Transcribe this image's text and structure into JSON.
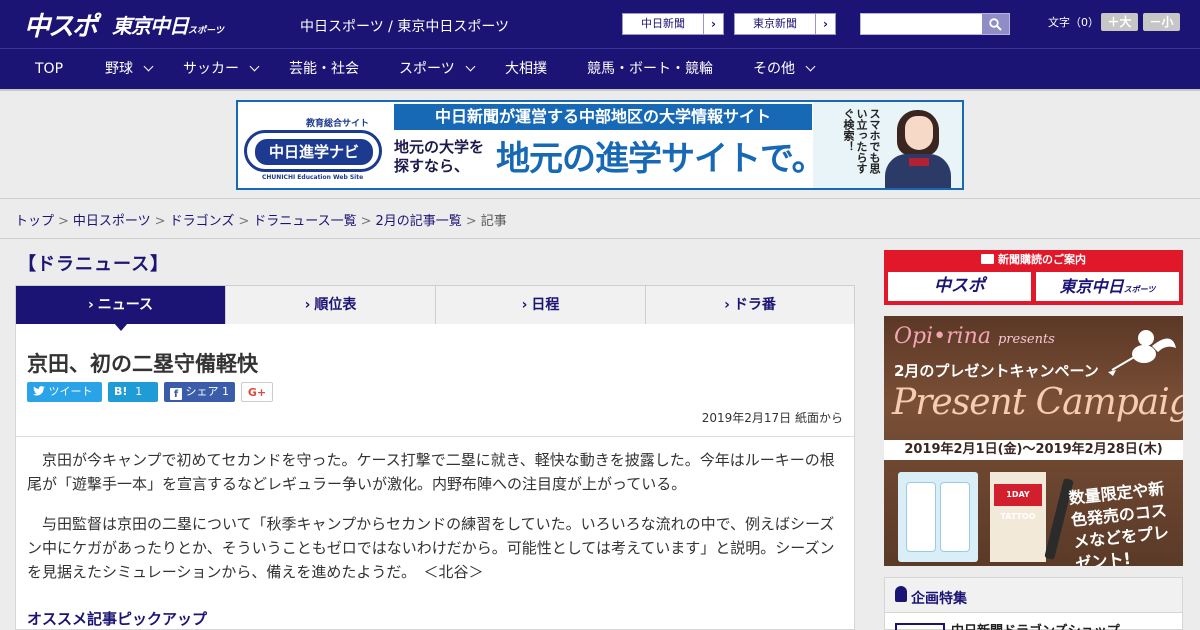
{
  "header": {
    "logo_chuspo": "中スポ",
    "logo_tokyo": "東京中日",
    "logo_tokyo_suffix": "スポーツ",
    "site_name": "中日スポーツ / 東京中日スポーツ",
    "link1": "中日新聞",
    "link2": "東京新聞",
    "link_arrow": "›",
    "search_placeholder": "",
    "fontsize_label": "文字（0）",
    "font_bigger": "＋大",
    "font_smaller": "－小"
  },
  "nav": {
    "items": [
      {
        "label": "TOP"
      },
      {
        "label": "野球"
      },
      {
        "label": "サッカー"
      },
      {
        "label": "芸能・社会"
      },
      {
        "label": "スポーツ"
      },
      {
        "label": "大相撲"
      },
      {
        "label": "競馬・ボート・競輪"
      },
      {
        "label": "その他"
      }
    ]
  },
  "banner": {
    "logo_top": "教育総合サイト",
    "logo_main": "中日進学ナビ",
    "logo_bottom": "CHUNICHI Education Web Site",
    "headline": "中日新聞が運営する中部地区の大学情報サイト",
    "sub_line1": "地元の大学を",
    "sub_line2": "探すなら、",
    "main": "地元の進学サイトで。",
    "side_copy": "スマホでも思い立ったらすぐ検索！"
  },
  "breadcrumb": {
    "items": [
      "トップ",
      "中日スポーツ",
      "ドラゴンズ",
      "ドラニュース一覧",
      "2月の記事一覧"
    ],
    "current": "記事",
    "separator": ">"
  },
  "section": {
    "title": "【ドラニュース】"
  },
  "tabs": [
    {
      "label": "ニュース",
      "active": true
    },
    {
      "label": "順位表",
      "active": false
    },
    {
      "label": "日程",
      "active": false
    },
    {
      "label": "ドラ番",
      "active": false
    }
  ],
  "article": {
    "title": "京田、初の二塁守備軽快",
    "share": {
      "tweet": "ツイート",
      "hatena_label": "B!",
      "hatena_count": "1",
      "facebook": "シェア",
      "facebook_count": "1",
      "gplus": "G+"
    },
    "date": "2019年2月17日 紙面から",
    "paragraphs": [
      "京田が今キャンプで初めてセカンドを守った。ケース打撃で二塁に就き、軽快な動きを披露した。今年はルーキーの根尾が「遊撃手一本」を宣言するなどレギュラー争いが激化。内野布陣への注目度が上がっている。",
      "与田監督は京田の二塁について「秋季キャンプからセカンドの練習をしていた。いろいろな流れの中で、例えばシーズン中にケガがあったりとか、そういうこともゼロではないわけだから。可能性としては考えています」と説明。シーズンを見据えたシミュレーションから、備えを進めたようだ。　＜北谷＞"
    ],
    "pickup_title": "オススメ記事ピックアップ"
  },
  "sidebar": {
    "subscribe_head": "新聞購読のご案内",
    "subscribe_logo1": "中スポ",
    "subscribe_logo2": "東京中日",
    "subscribe_logo2_suffix": "スポーツ",
    "ad": {
      "brand": "Opi•rina",
      "brand_suffix": "presents",
      "campaign": "2月のプレゼントキャンペーン",
      "big": "Present Campaign",
      "dates": "2019年2月1日(金)～2019年2月28日(木)",
      "product_label": "1DAY TATTOO",
      "copy": "数量限定や新色発売のコスメなどをプレゼント!"
    },
    "feature_title": "企画特集",
    "feature_item": "中日新聞ドラゴンズショップ"
  },
  "colors": {
    "brand_navy": "#1c1474",
    "banner_blue": "#1768b5",
    "subscribe_red": "#e0182a",
    "twitter": "#2aa3e8",
    "hatena": "#1f9bd6",
    "facebook": "#3b5ca8"
  }
}
